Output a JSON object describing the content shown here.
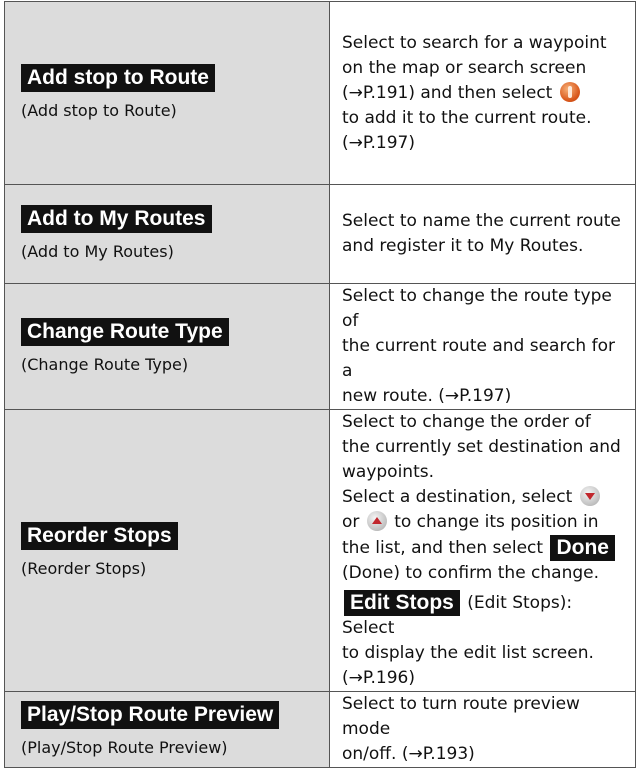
{
  "rows": [
    {
      "label": "Add stop to Route",
      "sub": "(Add stop to Route)",
      "desc_line1": "Select to search for a waypoint",
      "desc_line2": "on the map or search screen",
      "desc_line3a": "(→P.191) and then select",
      "icon": "route-go-icon",
      "desc_line4": "to add it to the current route.",
      "desc_line5": "(→P.197)"
    },
    {
      "label": "Add to My Routes",
      "sub": "(Add to My Routes)",
      "desc_line1": "Select to name the current route",
      "desc_line2": "and register it to My Routes."
    },
    {
      "label": "Change Route Type",
      "sub": "(Change Route Type)",
      "desc_line1": "Select to change the route type of",
      "desc_line2": "the current route and search for a",
      "desc_line3": "new route. (→P.197)"
    },
    {
      "label": "Reorder Stops",
      "sub": "(Reorder Stops)",
      "desc_line1": "Select to change the order of",
      "desc_line2": "the currently set destination and",
      "desc_line3": "waypoints.",
      "desc_line4": "Select a destination, select",
      "icon_down": "arrow-down-icon",
      "desc_line5a": "or",
      "icon_up": "arrow-up-icon",
      "desc_line5b": "to change its position in",
      "desc_line6a": "the list, and then select",
      "done_label": "Done",
      "desc_line7": "(Done) to confirm the change.",
      "edit_label": "Edit Stops",
      "desc_line8": "(Edit Stops): Select",
      "desc_line9": "to display the edit list screen.",
      "desc_line10": "(→P.196)"
    },
    {
      "label": "Play/Stop Route Preview",
      "sub": "(Play/Stop Route Preview)",
      "desc_line1": "Select to turn route preview mode",
      "desc_line2": "on/off. (→P.193)"
    }
  ]
}
